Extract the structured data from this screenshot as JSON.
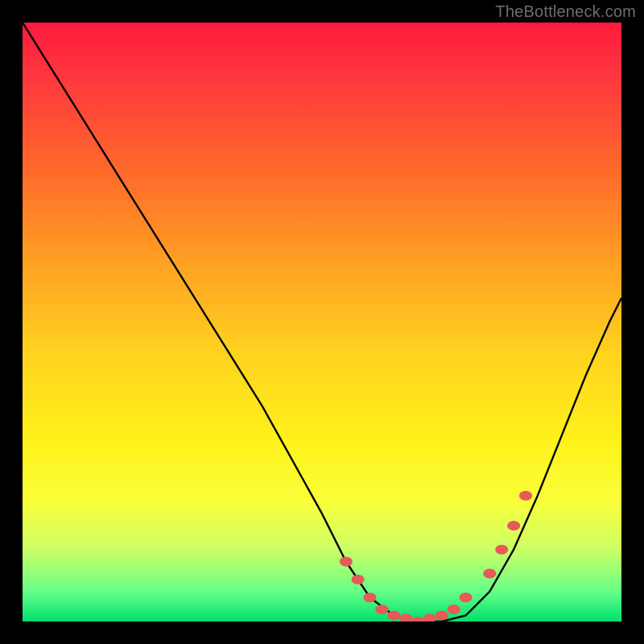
{
  "attribution": "TheBottleneck.com",
  "colors": {
    "background": "#000000",
    "gradient_top": "#ff1a3d",
    "gradient_bottom": "#00e070",
    "curve": "#000000",
    "marker": "#e85a5a",
    "attribution_text": "#6d6d6d"
  },
  "chart_data": {
    "type": "line",
    "title": "",
    "xlabel": "",
    "ylabel": "",
    "xlim": [
      0,
      100
    ],
    "ylim": [
      0,
      100
    ],
    "grid": false,
    "legend": false,
    "series": [
      {
        "name": "bottleneck-curve",
        "x": [
          0,
          5,
          10,
          15,
          20,
          25,
          30,
          35,
          40,
          45,
          50,
          54,
          58,
          62,
          66,
          70,
          74,
          78,
          82,
          86,
          90,
          94,
          98,
          100
        ],
        "y": [
          100,
          92,
          84,
          76,
          68,
          60,
          52,
          44,
          36,
          27,
          18,
          10,
          4,
          1,
          0,
          0,
          1,
          5,
          12,
          21,
          31,
          41,
          50,
          54
        ]
      }
    ],
    "markers": {
      "name": "highlighted-points",
      "x": [
        54,
        56,
        58,
        60,
        62,
        64,
        66,
        68,
        70,
        72,
        74,
        78,
        80,
        82,
        84
      ],
      "y": [
        10,
        7,
        4,
        2,
        1,
        0.5,
        0,
        0.5,
        1,
        2,
        4,
        8,
        12,
        16,
        21
      ]
    }
  }
}
